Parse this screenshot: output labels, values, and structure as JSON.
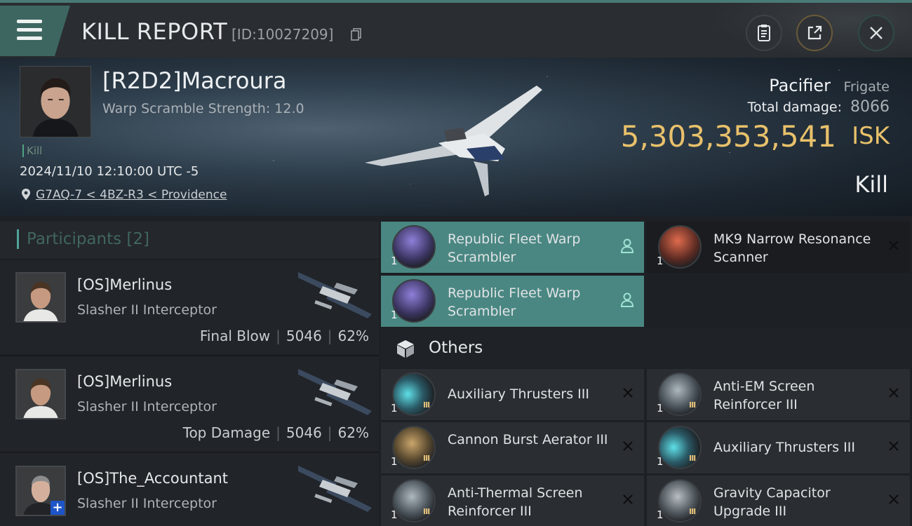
{
  "header": {
    "title": "KILL REPORT",
    "id_text": "[ID:10027209]"
  },
  "victim": {
    "name": "[R2D2]Macroura",
    "warp_scramble": "Warp Scramble Strength: 12.0",
    "tag": "Kill",
    "datetime": "2024/11/10 12:10:00 UTC -5",
    "location": "G7AQ-7 < 4BZ-R3 < Providence",
    "ship_name": "Pacifier",
    "ship_class": "Frigate",
    "total_damage_label": "Total damage:",
    "total_damage": "8066",
    "isk_value": "5,303,353,541",
    "isk_unit": "ISK",
    "result": "Kill"
  },
  "participants": {
    "title": "Participants [2]",
    "rows": [
      {
        "name": "[OS]Merlinus",
        "ship": "Slasher II Interceptor",
        "role": "Final Blow",
        "damage": "5046",
        "percent": "62%"
      },
      {
        "name": "[OS]Merlinus",
        "ship": "Slasher II Interceptor",
        "role": "Top Damage",
        "damage": "5046",
        "percent": "62%"
      },
      {
        "name": "[OS]The_Accountant",
        "ship": "Slasher II Interceptor"
      }
    ]
  },
  "items": {
    "top": [
      {
        "name": "Republic Fleet Warp Scrambler",
        "qty": "1"
      },
      {
        "name": "MK9 Narrow Resonance Scanner",
        "qty": "1"
      },
      {
        "name": "Republic Fleet Warp Scrambler",
        "qty": "1"
      }
    ],
    "others_title": "Others",
    "others": [
      {
        "name": "Auxiliary Thrusters III",
        "qty": "1",
        "tier": "III"
      },
      {
        "name": "Anti-EM Screen Reinforcer III",
        "qty": "1",
        "tier": "III"
      },
      {
        "name": "Cannon Burst Aerator III",
        "qty": "1",
        "tier": "III"
      },
      {
        "name": "Auxiliary Thrusters III",
        "qty": "1",
        "tier": "III"
      },
      {
        "name": "Anti-Thermal Screen Reinforcer III",
        "qty": "1",
        "tier": "III"
      },
      {
        "name": "Gravity Capacitor Upgrade III",
        "qty": "1",
        "tier": "III"
      }
    ]
  },
  "colors": {
    "accent": "#4a8782",
    "isk": "#e8c16b",
    "background": "#1d2024"
  },
  "icons": [
    "menu-icon",
    "copy-icon",
    "report-icon",
    "share-icon",
    "close-icon",
    "location-pin-icon",
    "person-icon",
    "remove-icon",
    "cube-icon"
  ]
}
